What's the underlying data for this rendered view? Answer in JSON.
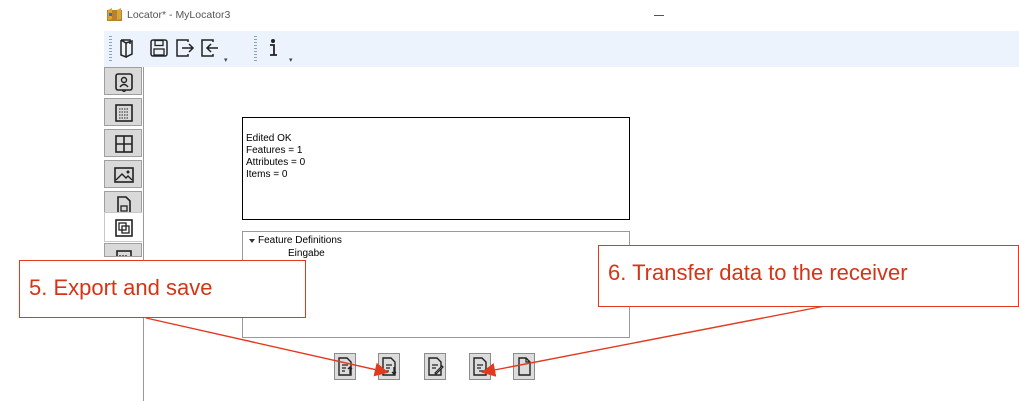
{
  "window": {
    "title": "Locator* - MyLocator3",
    "app_icon": "locator-app-icon",
    "minimize_icon": "minimize-icon"
  },
  "toolbar": {
    "buttons": [
      {
        "icon": "open-file-icon"
      },
      {
        "icon": "save-icon"
      },
      {
        "icon": "export-icon"
      },
      {
        "icon": "import-icon"
      },
      {
        "icon": "info-icon"
      }
    ],
    "dropdown_glyph": "▾"
  },
  "sidebar": {
    "items": [
      {
        "icon": "contact-card-icon"
      },
      {
        "icon": "list-grid-icon"
      },
      {
        "icon": "grid-icon"
      },
      {
        "icon": "image-icon"
      },
      {
        "icon": "document-icon"
      },
      {
        "icon": "feature-layer-icon",
        "active": true
      },
      {
        "icon": "table-icon"
      }
    ]
  },
  "status": {
    "lines": [
      "Edited OK",
      "Features = 1",
      "Attributes = 0",
      "Items = 0"
    ]
  },
  "tree": {
    "root": "Feature Definitions",
    "child": "Eingabe"
  },
  "actions": [
    {
      "icon": "document-import-icon"
    },
    {
      "icon": "document-export-icon"
    },
    {
      "icon": "document-edit-icon"
    },
    {
      "icon": "document-transfer-icon"
    },
    {
      "icon": "new-document-icon"
    }
  ],
  "annotations": {
    "left": "5. Export and save",
    "right": "6. Transfer data to the receiver",
    "color": "#e23a1f"
  }
}
